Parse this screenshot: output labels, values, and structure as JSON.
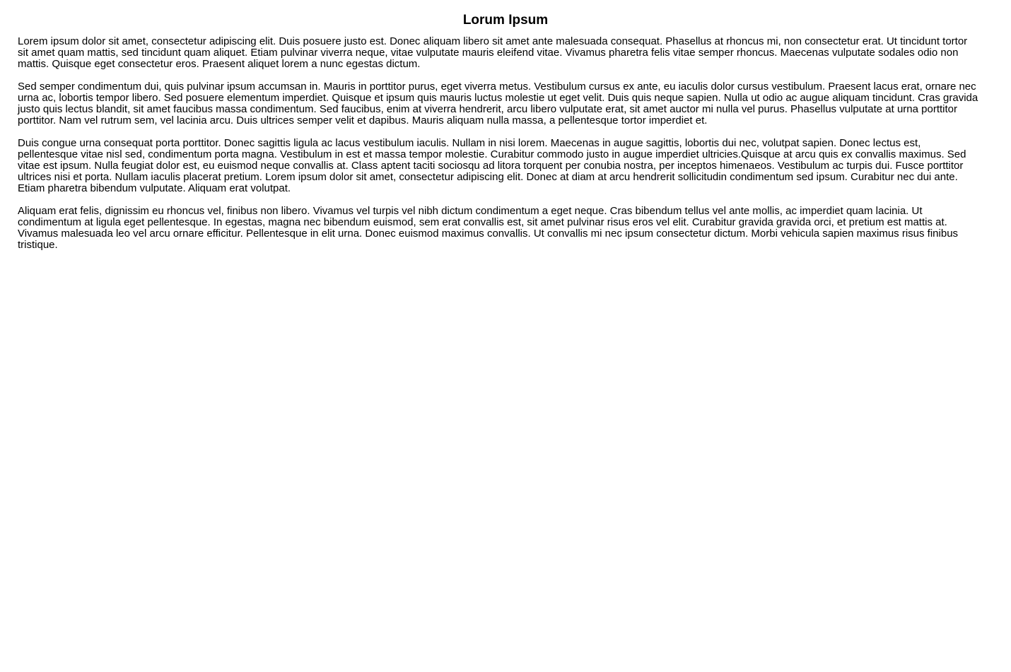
{
  "document": {
    "title": "Lorum Ipsum",
    "paragraphs": [
      "Lorem ipsum dolor sit amet, consectetur adipiscing elit. Duis posuere justo est. Donec aliquam libero sit amet ante malesuada consequat. Phasellus at rhoncus mi, non consectetur erat. Ut tincidunt tortor sit amet quam mattis, sed tincidunt quam aliquet. Etiam pulvinar viverra neque, vitae vulputate mauris eleifend vitae. Vivamus pharetra felis vitae semper rhoncus. Maecenas vulputate sodales odio non mattis. Quisque eget consectetur eros. Praesent aliquet lorem a nunc egestas dictum.",
      "Sed semper condimentum dui, quis pulvinar ipsum accumsan in. Mauris in porttitor purus, eget viverra metus. Vestibulum cursus ex ante, eu iaculis dolor cursus vestibulum. Praesent lacus erat, ornare nec urna ac, lobortis tempor libero. Sed posuere elementum imperdiet. Quisque et ipsum quis mauris luctus molestie ut eget velit. Duis quis neque sapien. Nulla ut odio ac augue aliquam tincidunt. Cras gravida justo quis lectus blandit, sit amet faucibus massa condimentum. Sed faucibus, enim at viverra hendrerit, arcu libero vulputate erat, sit amet auctor mi nulla vel purus. Phasellus vulputate at urna porttitor porttitor. Nam vel rutrum sem, vel lacinia arcu. Duis ultrices semper velit et dapibus. Mauris aliquam nulla massa, a pellentesque tortor imperdiet et.",
      "Duis congue urna consequat porta porttitor. Donec sagittis ligula ac lacus vestibulum iaculis. Nullam in nisi lorem. Maecenas in augue sagittis, lobortis dui nec, volutpat sapien. Donec lectus est, pellentesque vitae nisl sed, condimentum porta magna. Vestibulum in est et massa tempor molestie. Curabitur commodo justo in augue imperdiet ultricies.Quisque at arcu quis ex convallis maximus. Sed vitae est ipsum. Nulla feugiat dolor est, eu euismod neque convallis at. Class aptent taciti sociosqu ad litora torquent per conubia nostra, per inceptos himenaeos. Vestibulum ac turpis dui. Fusce porttitor ultrices nisi et porta. Nullam iaculis placerat pretium. Lorem ipsum dolor sit amet, consectetur adipiscing elit. Donec at diam at arcu hendrerit sollicitudin condimentum sed ipsum. Curabitur nec dui ante. Etiam pharetra bibendum vulputate. Aliquam erat volutpat.",
      "Aliquam erat felis, dignissim eu rhoncus vel, finibus non libero. Vivamus vel turpis vel nibh dictum condimentum a eget neque. Cras bibendum tellus vel ante mollis, ac imperdiet quam lacinia. Ut condimentum at ligula eget pellentesque. In egestas, magna nec bibendum euismod, sem erat convallis est, sit amet pulvinar risus eros vel elit. Curabitur gravida gravida orci, et pretium est mattis at. Vivamus malesuada leo vel arcu ornare efficitur. Pellentesque in elit urna. Donec euismod maximus convallis. Ut convallis mi nec ipsum consectetur dictum. Morbi vehicula sapien maximus risus finibus tristique."
    ]
  }
}
